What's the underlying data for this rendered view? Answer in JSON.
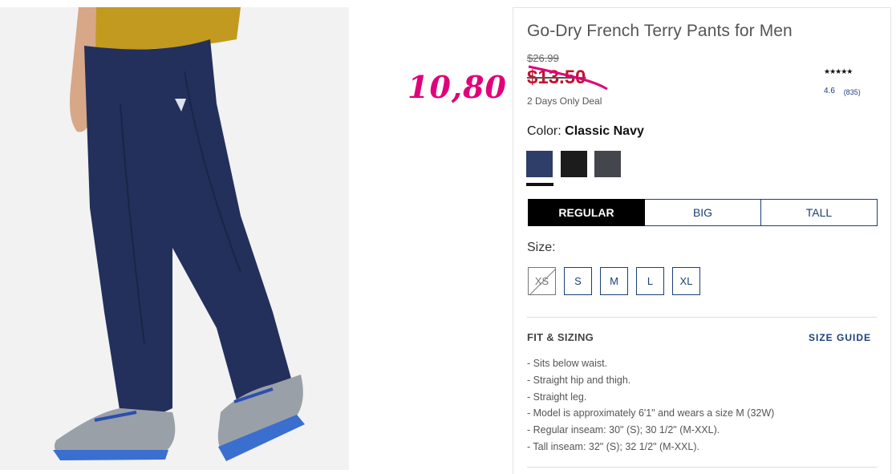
{
  "annotation": {
    "handwritten_price": "10,80",
    "color": "#e0007a"
  },
  "product": {
    "title": "Go-Dry French Terry Pants for Men",
    "original_price": "$26.99",
    "sale_price": "$13.50",
    "deal_text": "2 Days Only Deal",
    "rating": {
      "stars": "★★★★★",
      "value": "4.6",
      "count": "(835)"
    }
  },
  "color": {
    "label": "Color:",
    "selected": "Classic Navy",
    "swatches": [
      {
        "name": "Classic Navy",
        "hex": "#2f3e68"
      },
      {
        "name": "Black",
        "hex": "#1c1c1c"
      },
      {
        "name": "Charcoal",
        "hex": "#43464c"
      }
    ]
  },
  "fit_tabs": [
    "REGULAR",
    "BIG",
    "TALL"
  ],
  "size": {
    "label": "Size:",
    "options": [
      "XS",
      "S",
      "M",
      "L",
      "XL"
    ]
  },
  "fit_sizing": {
    "heading": "FIT & SIZING",
    "size_guide": "SIZE GUIDE",
    "details": [
      "Sits below waist.",
      "Straight hip and thigh.",
      "Straight leg.",
      "Model is approximately 6'1\" and wears a size M (32W)",
      "Regular inseam: 30\" (S); 30 1/2\" (M-XXL).",
      "Tall inseam: 32\" (S); 32 1/2\" (M-XXL)."
    ]
  },
  "colors": {
    "accent_navy": "#1b3f7a",
    "sale_red": "#c8102e"
  }
}
